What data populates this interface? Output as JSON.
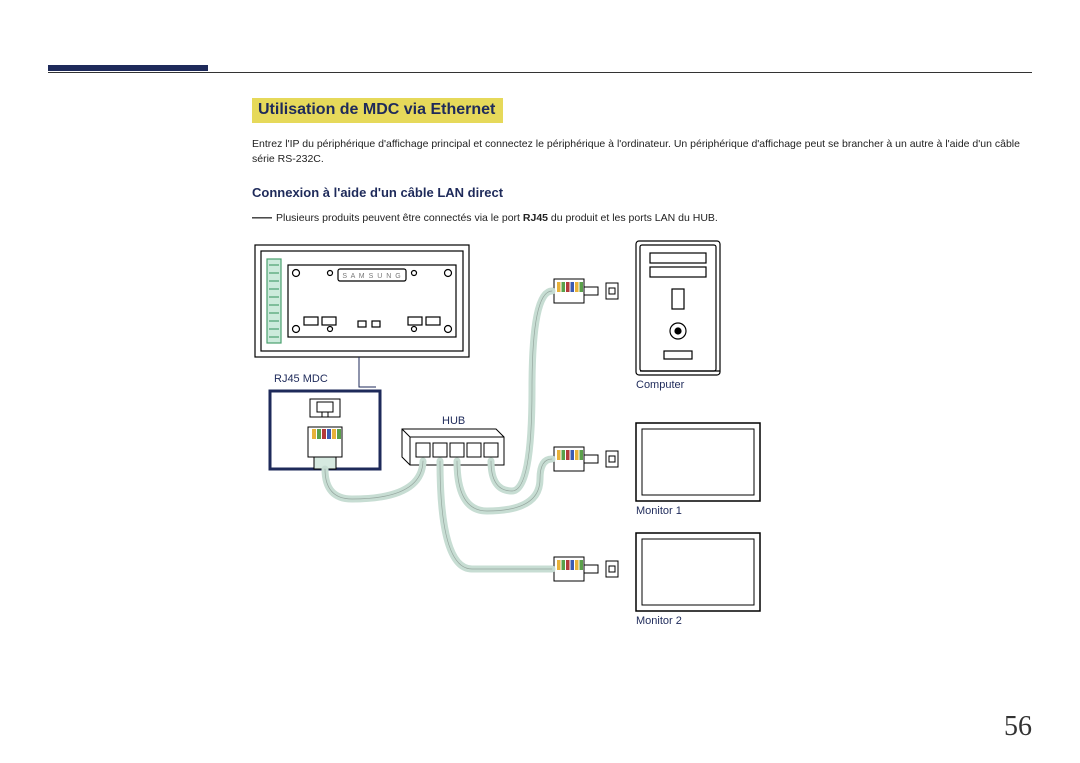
{
  "section_title": "Utilisation de MDC via Ethernet",
  "intro": "Entrez l'IP du périphérique d'affichage principal et connectez le périphérique à l'ordinateur. Un périphérique d'affichage peut se brancher à un autre à l'aide d'un câble série RS-232C.",
  "sub_title": "Connexion à l'aide d'un câble LAN direct",
  "note_prefix": "Plusieurs produits peuvent être connectés via le port ",
  "note_bold": "RJ45",
  "note_suffix": " du produit et les ports LAN du HUB.",
  "labels": {
    "rj45": "RJ45 MDC",
    "hub": "HUB",
    "computer": "Computer",
    "monitor1": "Monitor 1",
    "monitor2": "Monitor 2"
  },
  "page_number": "56"
}
